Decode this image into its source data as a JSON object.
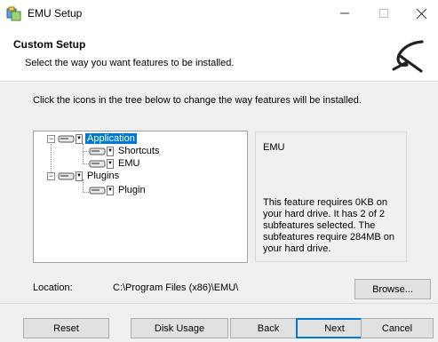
{
  "window": {
    "title": "EMU Setup",
    "controls": {
      "minimize": "—",
      "maximize": "☐",
      "close": "✕"
    }
  },
  "header": {
    "title": "Custom Setup",
    "subtitle": "Select the way you want features to be installed.",
    "logo_icon": "emu-logo-icon"
  },
  "instruction": "Click the icons in the tree below to change the way features will be installed.",
  "tree": {
    "items": [
      {
        "label": "Application",
        "selected": true,
        "expander": "−",
        "level": 0
      },
      {
        "label": "Shortcuts",
        "selected": false,
        "level": 1
      },
      {
        "label": "EMU",
        "selected": false,
        "level": 1
      },
      {
        "label": "Plugins",
        "selected": false,
        "expander": "−",
        "level": 0
      },
      {
        "label": "Plugin",
        "selected": false,
        "level": 1
      }
    ]
  },
  "description": {
    "name": "EMU",
    "detail": "This feature requires 0KB on your hard drive. It has 2 of 2 subfeatures selected. The subfeatures require 284MB on your hard drive."
  },
  "location": {
    "label": "Location:",
    "value": "C:\\Program Files (x86)\\EMU\\"
  },
  "buttons": {
    "browse": "Browse...",
    "reset": "Reset",
    "disk_usage": "Disk Usage",
    "back": "Back",
    "next": "Next",
    "cancel": "Cancel"
  },
  "colors": {
    "selection": "#0078d7",
    "panel": "#f0f0f0"
  }
}
